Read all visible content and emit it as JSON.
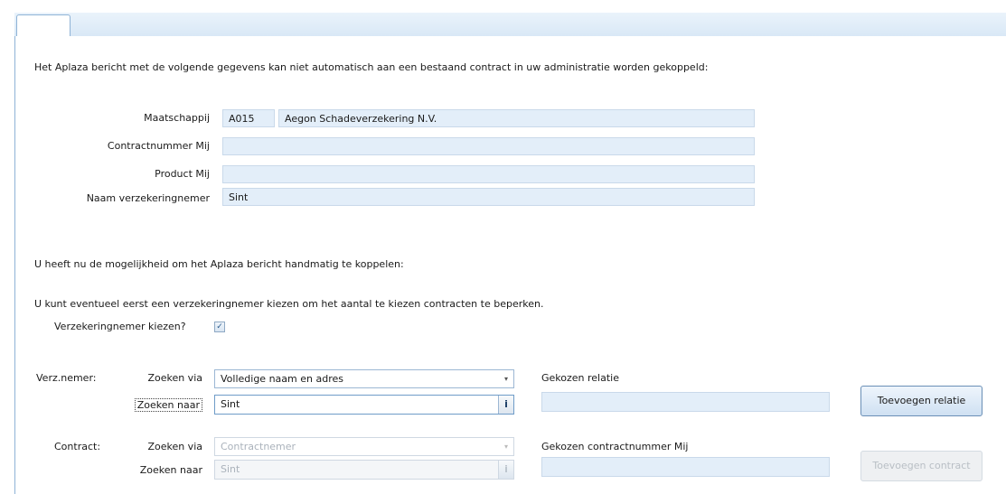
{
  "intro_text": "Het Aplaza bericht met de volgende gegevens kan niet automatisch aan een bestaand contract in uw administratie worden gekoppeld:",
  "details": {
    "maatschappij_label": "Maatschappij",
    "maatschappij_code": "A015",
    "maatschappij_name": "Aegon Schadeverzekering N.V.",
    "contractnummer_label": "Contractnummer Mij",
    "contractnummer_value": "",
    "product_label": "Product Mij",
    "product_value": "",
    "naam_label": "Naam verzekeringnemer",
    "naam_value": "Sint"
  },
  "manual_text": "U heeft nu de mogelijkheid om het Aplaza bericht handmatig te koppelen:",
  "hint_text": "U kunt eventueel eerst een verzekeringnemer kiezen om het aantal te kiezen contracten te beperken.",
  "checkbox": {
    "label": "Verzekeringnemer kiezen?",
    "checked": true,
    "mark": "✓"
  },
  "verz": {
    "section_label": "Verz.nemer:",
    "zoeken_via_label": "Zoeken via",
    "zoeken_via_value": "Volledige naam en adres",
    "zoeken_naar_label": "Zoeken naar",
    "zoeken_naar_value": "Sint",
    "gekozen_label": "Gekozen relatie",
    "gekozen_value": "",
    "button": "Toevoegen relatie"
  },
  "contract": {
    "section_label": "Contract:",
    "zoeken_via_label": "Zoeken via",
    "zoeken_via_value": "Contractnemer",
    "zoeken_naar_label": "Zoeken naar",
    "zoeken_naar_value": "Sint",
    "gekozen_label": "Gekozen contractnummer Mij",
    "gekozen_value": "",
    "button": "Toevoegen contract"
  },
  "icons": {
    "info": "i",
    "dropdown": "▾"
  },
  "colors": {
    "field_bg": "#e3eef9",
    "border_accent": "#8fb3d6"
  }
}
